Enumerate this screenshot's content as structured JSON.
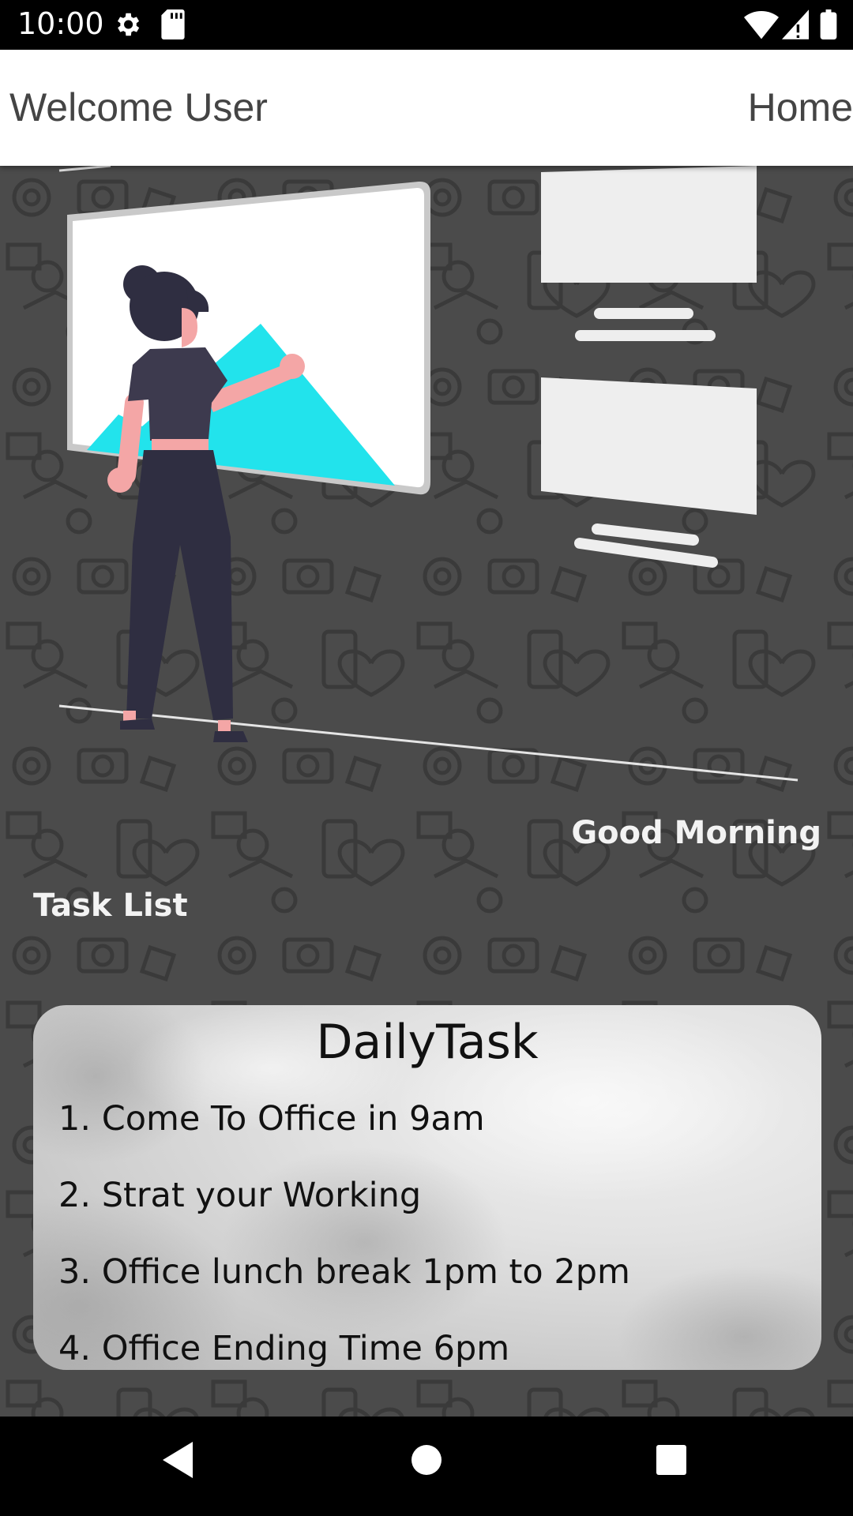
{
  "status_bar": {
    "time": "10:00",
    "icons": [
      "gear-icon",
      "sd-card-icon",
      "wifi-icon",
      "signal-icon",
      "battery-icon"
    ]
  },
  "app_bar": {
    "title": "Welcome User",
    "home_label": "Home"
  },
  "main": {
    "greeting": "Good Morning",
    "task_list_label": "Task List"
  },
  "card": {
    "title": "DailyTask",
    "items": [
      "1. Come To Office in 9am",
      "2. Strat your Working",
      "3. Office lunch break 1pm to 2pm",
      "4. Office Ending Time 6pm"
    ]
  },
  "nav_bar": {
    "icons": [
      "back-icon",
      "home-icon",
      "recents-icon"
    ]
  },
  "colors": {
    "background": "#4b4b4b",
    "accent_cyan": "#22e3ec",
    "figure_dark": "#2f2e41",
    "skin": "#f4a6a6"
  }
}
